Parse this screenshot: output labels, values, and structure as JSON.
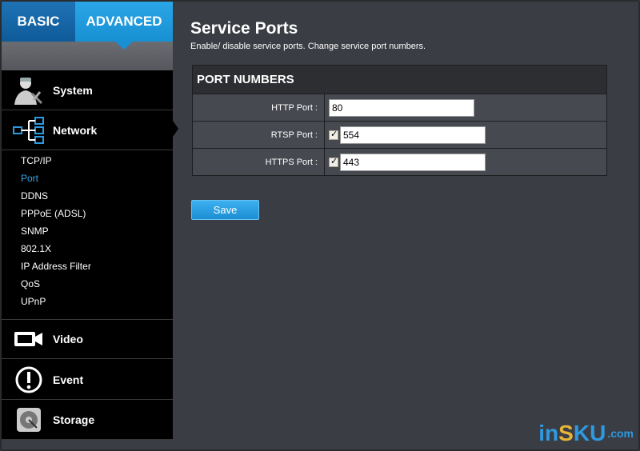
{
  "tabs": {
    "basic": "BASIC",
    "advanced": "ADVANCED"
  },
  "nav": {
    "system": "System",
    "network": "Network",
    "network_items": [
      "TCP/IP",
      "Port",
      "DDNS",
      "PPPoE (ADSL)",
      "SNMP",
      "802.1X",
      "IP Address Filter",
      "QoS",
      "UPnP"
    ],
    "active_item": "Port",
    "video": "Video",
    "event": "Event",
    "storage": "Storage"
  },
  "page": {
    "title": "Service Ports",
    "subtitle": "Enable/ disable service ports. Change service port numbers."
  },
  "panel": {
    "heading": "PORT NUMBERS",
    "http": {
      "label": "HTTP Port :",
      "value": "80"
    },
    "rtsp": {
      "label": "RTSP Port :",
      "value": "554",
      "enabled": true
    },
    "https": {
      "label": "HTTPS Port :",
      "value": "443",
      "enabled": true
    }
  },
  "save_label": "Save",
  "watermark": {
    "p1": "in",
    "p2": "S",
    "p3": "KU",
    "p4": ".com"
  },
  "colors": {
    "accent": "#1890d3",
    "active_link": "#35a6e8"
  }
}
